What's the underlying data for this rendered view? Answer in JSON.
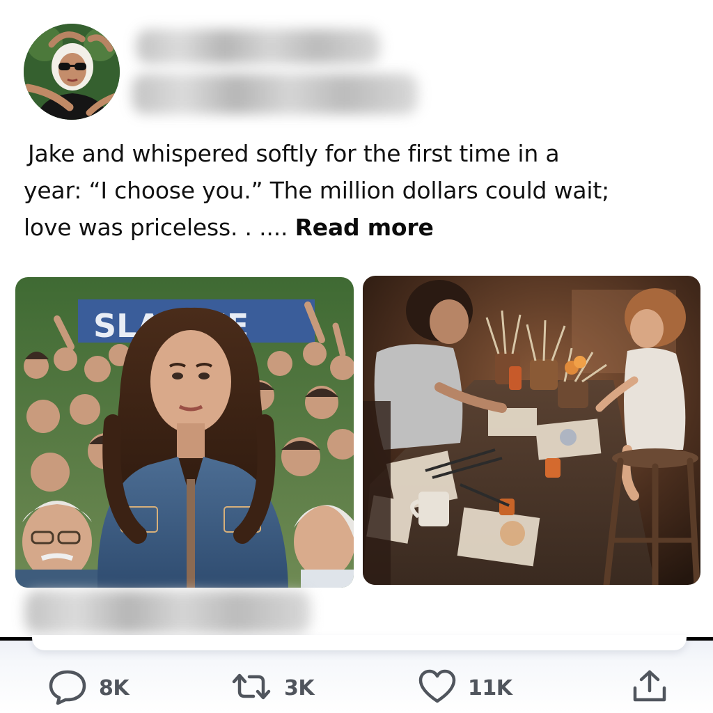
{
  "post": {
    "text_lines": [
      "Jake and whispered softly for the first time in a",
      "year: “I choose you.” The million dollars could wait;",
      "love was priceless. . ...."
    ],
    "read_more_label": "Read more"
  },
  "images": {
    "left_banner_text": "SLA     LIFE",
    "right_alt": ""
  },
  "actions": {
    "reply": {
      "icon": "speech-bubble-icon",
      "count": "8K"
    },
    "retweet": {
      "icon": "retweet-arrows-icon",
      "count": "3K"
    },
    "like": {
      "icon": "heart-icon",
      "count": "11K"
    },
    "share": {
      "icon": "share-upload-icon"
    }
  },
  "colors": {
    "text": "#111111",
    "action_gray": "#50555d",
    "divider": "#000000",
    "footer_tint": "#eef1f7"
  }
}
